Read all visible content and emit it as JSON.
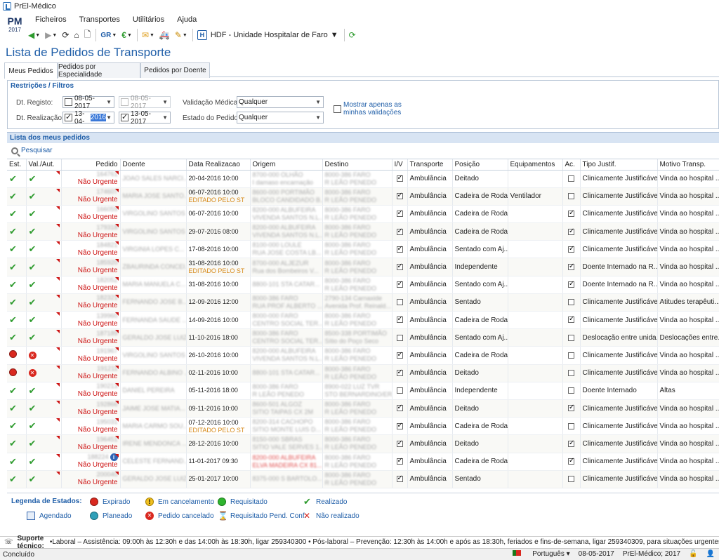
{
  "window": {
    "title": "PrEl-Médico"
  },
  "logo": {
    "text": "PM",
    "year": "2017"
  },
  "menu": [
    "Ficheiros",
    "Transportes",
    "Utilitários",
    "Ajuda"
  ],
  "toolbar": {
    "hospital": "HDF - Unidade Hospitalar de Faro"
  },
  "page": {
    "title": "Lista de Pedidos de Transporte"
  },
  "tabs": [
    "Meus Pedidos",
    "Pedidos por Especialidade",
    "Pedidos por Doente"
  ],
  "filters": {
    "title": "Restrições / Filtros",
    "registo_label": "Dt. Registo:",
    "registo_from": "08-05-2017",
    "registo_to": "08-05-2017",
    "realizacao_label": "Dt. Realização:",
    "realizacao_from_a": "13-04-",
    "realizacao_from_b": "2016",
    "realizacao_to": "13-05-2017",
    "validacao_label": "Validação Médica:",
    "validacao_value": "Qualquer",
    "estado_label": "Estado do Pedido:",
    "estado_value": "Qualquer",
    "mostrar_label_1": "Mostrar apenas as",
    "mostrar_label_2": "minhas validações"
  },
  "list": {
    "title": "Lista dos meus pedidos",
    "search": "Pesquisar"
  },
  "columns": [
    "Est.",
    "Val./Aut.",
    "Pedido",
    "Doente",
    "Data Realizacao",
    "Origem",
    "Destino",
    "I/V",
    "Transporte",
    "Posição",
    "Equipamentos",
    "Ac.",
    "Tipo Justif.",
    "Motivo Transp."
  ],
  "rows": [
    {
      "est": "ok",
      "val": "ok",
      "num": "164761",
      "urg": "Não Urgente",
      "doente": "JOAO SALES NARCI...",
      "data": "20-04-2016 10:00",
      "edit": "",
      "orig1": "8700-000 OLHÃO",
      "orig2": "I damaso encarnação",
      "dest1": "8000-386 FARO",
      "dest2": "R LEÃO PENEDO",
      "iv": true,
      "transp": "Ambulância",
      "pos": "Deitado",
      "equip": "",
      "ac": false,
      "tipo": "Clinicamente Justificável...",
      "motivo": "Vinda ao hospital ..."
    },
    {
      "est": "ok",
      "val": "ok",
      "num": "174607",
      "urg": "Não Urgente",
      "doente": "MARIA JOSE SANTO...",
      "data": "06-07-2016 10:00",
      "edit": "EDITADO PELO ST",
      "orig1": "8600-000 PORTIMÃO",
      "orig2": "BLOCO CANDIDADO B...",
      "dest1": "8000-386 FARO",
      "dest2": "R LEÃO PENEDO",
      "iv": true,
      "transp": "Ambulância",
      "pos": "Cadeira de Rodas",
      "equip": "Ventilador",
      "ac": false,
      "tipo": "Clinicamente Justificável...",
      "motivo": "Vinda ao hospital ..."
    },
    {
      "est": "ok",
      "val": "ok",
      "num": "166059",
      "urg": "Não Urgente",
      "doente": "VIRGOLINO SANTOS",
      "data": "06-07-2016 10:00",
      "edit": "",
      "orig1": "8200-000 ALBUFEIRA",
      "orig2": "VIVENDA SANTOS N.L...",
      "dest1": "8000-386 FARO",
      "dest2": "R LEÃO PENEDO",
      "iv": true,
      "transp": "Ambulância",
      "pos": "Cadeira de Rodas",
      "equip": "",
      "ac": true,
      "tipo": "Clinicamente Justificável...",
      "motivo": "Vinda ao hospital ..."
    },
    {
      "est": "ok",
      "val": "ok",
      "num": "179318",
      "urg": "Não Urgente",
      "doente": "VIRGOLINO SANTOS",
      "data": "29-07-2016 08:00",
      "edit": "",
      "orig1": "8200-000 ALBUFEIRA",
      "orig2": "VIVENDA SANTOS N.L...",
      "dest1": "8000-386 FARO",
      "dest2": "R LEÃO PENEDO",
      "iv": true,
      "transp": "Ambulância",
      "pos": "Cadeira de Rodas",
      "equip": "",
      "ac": true,
      "tipo": "Clinicamente Justificável...",
      "motivo": "Vinda ao hospital ..."
    },
    {
      "est": "ok",
      "val": "ok",
      "num": "184821",
      "urg": "Não Urgente",
      "doente": "VIRGINIA LOPES C...",
      "data": "17-08-2016 10:00",
      "edit": "",
      "orig1": "8100-000 LOULE",
      "orig2": "RUA JOSE COSTA LB...",
      "dest1": "8000-386 FARO",
      "dest2": "R LEÃO PENEDO",
      "iv": true,
      "transp": "Ambulância",
      "pos": "Sentado com Aj...",
      "equip": "",
      "ac": true,
      "tipo": "Clinicamente Justificável...",
      "motivo": "Vinda ao hospital ..."
    },
    {
      "est": "ok",
      "val": "ok",
      "num": "185920",
      "urg": "Não Urgente",
      "doente": "ZBAURINDA CONCEI...",
      "data": "31-08-2016 10:00",
      "edit": "EDITADO PELO ST",
      "orig1": "8700-000 ALJEZUR",
      "orig2": "Rua dos Bombeiros V...",
      "dest1": "8000-386 FARO",
      "dest2": "R LEÃO PENEDO",
      "iv": true,
      "transp": "Ambulância",
      "pos": "Independente",
      "equip": "",
      "ac": true,
      "tipo": "Doente Internado na R...",
      "motivo": "Vinda ao hospital ..."
    },
    {
      "est": "ok",
      "val": "ok",
      "num": "182052",
      "urg": "Não Urgente",
      "doente": "MARIA MANUELA C...",
      "data": "31-08-2016 10:00",
      "edit": "",
      "orig1": "8800-101 STA CATAR...",
      "orig2": "",
      "dest1": "8000-386 FARO",
      "dest2": "R LEÃO PENEDO",
      "iv": true,
      "transp": "Ambulância",
      "pos": "Sentado com Aj...",
      "equip": "",
      "ac": true,
      "tipo": "Doente Internado na R...",
      "motivo": "Vinda ao hospital ..."
    },
    {
      "est": "ok",
      "val": "ok",
      "num": "182321",
      "urg": "Não Urgente",
      "doente": "FERNANDO JOSE B...",
      "data": "12-09-2016 12:00",
      "edit": "",
      "orig1": "8000-386 FARO",
      "orig2": "RUA PROF ALBERTO ...",
      "dest1": "2790-134 Carnaxide",
      "dest2": "Avenida Prof. Reinald...",
      "iv": false,
      "transp": "Ambulância",
      "pos": "Sentado",
      "equip": "",
      "ac": false,
      "tipo": "Clinicamente Justificável...",
      "motivo": "Atitudes terapêuti..."
    },
    {
      "est": "ok",
      "val": "ok",
      "num": "139960",
      "urg": "Não Urgente",
      "doente": "FERNANDA SAUDE ...",
      "data": "14-09-2016 10:00",
      "edit": "",
      "orig1": "8000-000 FARO",
      "orig2": "CENTRO SOCIAL TER...",
      "dest1": "8000-386 FARO",
      "dest2": "R LEÃO PENEDO",
      "iv": true,
      "transp": "Ambulância",
      "pos": "Cadeira de Rodas",
      "equip": "",
      "ac": true,
      "tipo": "Clinicamente Justificável...",
      "motivo": "Vinda ao hospital ..."
    },
    {
      "est": "ok",
      "val": "ok",
      "num": "187189",
      "urg": "Não Urgente",
      "doente": "GERALDO JOSE LUIZ...",
      "data": "11-10-2016 18:00",
      "edit": "",
      "orig1": "8000-386 FARO",
      "orig2": "CENTRO SOCIAL TER...",
      "dest1": "8500-338 PORTIMÃO",
      "dest2": "Sítio do Poço Seco",
      "iv": false,
      "transp": "Ambulância",
      "pos": "Sentado com Aj...",
      "equip": "",
      "ac": false,
      "tipo": "Deslocação entre unida...",
      "motivo": "Deslocações entre..."
    },
    {
      "est": "exp",
      "val": "cancel",
      "num": "191967",
      "urg": "Não Urgente",
      "doente": "VIRGOLINO SANTOS",
      "data": "26-10-2016 10:00",
      "edit": "",
      "orig1": "8200-000 ALBUFEIRA",
      "orig2": "VIVENDA SANTOS N.L...",
      "dest1": "8000-386 FARO",
      "dest2": "R LEÃO PENEDO",
      "iv": true,
      "transp": "Ambulância",
      "pos": "Cadeira de Rodas",
      "equip": "",
      "ac": false,
      "tipo": "Clinicamente Justificável...",
      "motivo": "Vinda ao hospital ..."
    },
    {
      "est": "exp",
      "val": "cancel",
      "num": "191211",
      "urg": "Não Urgente",
      "doente": "FERNANDO ALBINO ...",
      "data": "02-11-2016 10:00",
      "edit": "",
      "orig1": "8800-101 STA CATAR...",
      "orig2": "",
      "dest1": "8000-386 FARO",
      "dest2": "R LEÃO PENEDO",
      "iv": true,
      "transp": "Ambulância",
      "pos": "Deitado",
      "equip": "",
      "ac": false,
      "tipo": "Clinicamente Justificável...",
      "motivo": "Vinda ao hospital ..."
    },
    {
      "est": "ok",
      "val": "ok",
      "num": "190213",
      "urg": "Não Urgente",
      "doente": "DANIEL PEREIRA",
      "data": "05-11-2016 18:00",
      "edit": "",
      "orig1": "8000-386 FARO",
      "orig2": "R LEÃO PENEDO",
      "dest1": "8900-022 LUZ TVR",
      "dest2": "STO BERNARDINO/ER...",
      "iv": false,
      "transp": "Ambulância",
      "pos": "Independente",
      "equip": "",
      "ac": false,
      "tipo": "Doente Internado",
      "motivo": "Altas"
    },
    {
      "est": "ok",
      "val": "ok",
      "num": "192866",
      "urg": "Não Urgente",
      "doente": "JAIME JOSE MATIA...",
      "data": "09-11-2016 10:00",
      "edit": "",
      "orig1": "8600-501 ALGOZ",
      "orig2": "SITIO TAIPAS CX 2M",
      "dest1": "8000-386 FARO",
      "dest2": "R LEÃO PENEDO",
      "iv": true,
      "transp": "Ambulância",
      "pos": "Deitado",
      "equip": "",
      "ac": true,
      "tipo": "Clinicamente Justificável...",
      "motivo": "Vinda ao hospital ..."
    },
    {
      "est": "ok",
      "val": "ok",
      "num": "195031",
      "urg": "Não Urgente",
      "doente": "MARIA CARMO SOU...",
      "data": "07-12-2016 10:00",
      "edit": "EDITADO PELO ST",
      "orig1": "8200-314 CACHOPO",
      "orig2": "SITIO MONTE LUIS D...",
      "dest1": "8000-386 FARO",
      "dest2": "R LEÃO PENEDO",
      "iv": true,
      "transp": "Ambulância",
      "pos": "Cadeira de Rodas",
      "equip": "",
      "ac": false,
      "tipo": "Clinicamente Justificável...",
      "motivo": "Vinda ao hospital ..."
    },
    {
      "est": "ok",
      "val": "ok",
      "num": "196451",
      "urg": "Não Urgente",
      "doente": "IRENE MENDONCA ...",
      "data": "28-12-2016 10:00",
      "edit": "",
      "orig1": "8150-000 SBRAS",
      "orig2": "SITIO VALE SERVES 1...",
      "dest1": "8000-386 FARO",
      "dest2": "R LEÃO PENEDO",
      "iv": true,
      "transp": "Ambulância",
      "pos": "Deitado",
      "equip": "",
      "ac": true,
      "tipo": "Clinicamente Justificável...",
      "motivo": "Vinda ao hospital ..."
    },
    {
      "est": "ok",
      "val": "ok",
      "num": "188224",
      "urg": "Não Urgente",
      "doente": "CELESTE FERNAND...",
      "data": "11-01-2017 09:30",
      "edit": "",
      "orig1": "8200-000 ALBUFEIRA",
      "orig2": "ELVA MADEIRA CX 81...",
      "origred": true,
      "dest1": "8000-386 FARO",
      "dest2": "R LEÃO PENEDO",
      "iv": true,
      "transp": "Ambulância",
      "pos": "Cadeira de Rodas",
      "equip": "",
      "ac": true,
      "tipo": "Clinicamente Justificável...",
      "motivo": "Vinda ao hospital ..."
    },
    {
      "est": "ok",
      "val": "ok",
      "num": "200040",
      "urg": "Não Urgente",
      "doente": "GERALDO JOSE LUIZ...",
      "data": "25-01-2017 10:00",
      "edit": "",
      "orig1": "8375-000 S BARTOLO...",
      "orig2": "",
      "dest1": "8000-386 FARO",
      "dest2": "R LEÃO PENEDO",
      "iv": true,
      "transp": "Ambulância",
      "pos": "Sentado",
      "equip": "",
      "ac": false,
      "tipo": "Clinicamente Justificável...",
      "motivo": "Vinda ao hospital ..."
    }
  ],
  "legend": {
    "title": "Legenda de Estados:",
    "expirado": "Expirado",
    "cancelamento": "Em cancelamento",
    "requisitado": "Requisitado",
    "realizado": "Realizado",
    "agendado": "Agendado",
    "planeado": "Planeado",
    "cancelado": "Pedido cancelado",
    "pendconf": "Requisitado Pend. Conf.",
    "naorealizado": "Não realizado"
  },
  "support": {
    "label": "Suporte técnico:",
    "text": "•Laboral – Assistência: 09:00h às 12:30h e das 14:00h às 18:30h, ligar 259340300 • Pós-laboral – Prevenção: 12:30h às 14:00h e após as 18:30h, feriados e fins-de-semana, ligar 259340309, para situações urgentes."
  },
  "status": {
    "left": "Concluído",
    "lang": "Português",
    "date": "08-05-2017",
    "app": "PrEl-Médico; 2017"
  }
}
